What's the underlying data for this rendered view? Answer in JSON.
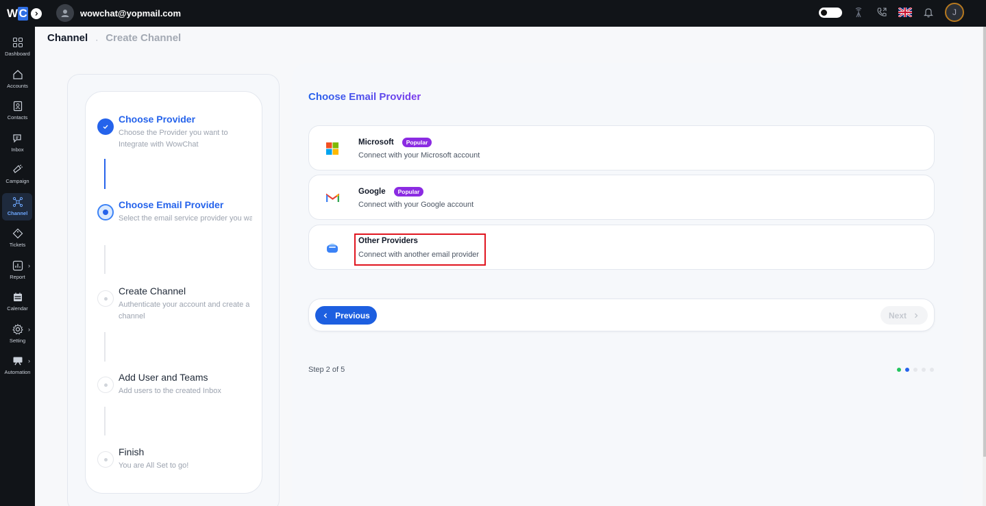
{
  "app": {
    "user_email": "wowchat@yopmail.com",
    "profile_initial": "J"
  },
  "sidebar": {
    "items": [
      {
        "label": "Dashboard",
        "icon": "dashboard-icon"
      },
      {
        "label": "Accounts",
        "icon": "home-icon"
      },
      {
        "label": "Contacts",
        "icon": "contact-card-icon"
      },
      {
        "label": "Inbox",
        "icon": "chat-icon"
      },
      {
        "label": "Campaign",
        "icon": "megaphone-icon"
      },
      {
        "label": "Channel",
        "icon": "channel-icon",
        "active": true
      },
      {
        "label": "Tickets",
        "icon": "ticket-icon"
      },
      {
        "label": "Report",
        "icon": "report-icon"
      },
      {
        "label": "Calendar",
        "icon": "calendar-icon"
      },
      {
        "label": "Setting",
        "icon": "gear-icon"
      },
      {
        "label": "Automation",
        "icon": "automation-icon"
      }
    ]
  },
  "breadcrumb": {
    "parent": "Channel",
    "separator": "·",
    "current": "Create Channel"
  },
  "steps": [
    {
      "title": "Choose Provider",
      "desc": "Choose the Provider you want to Integrate with WowChat",
      "state": "done"
    },
    {
      "title": "Choose Email Provider",
      "desc": "Select the email service provider you want to use for sending and receiving...",
      "state": "current"
    },
    {
      "title": "Create Channel",
      "desc": "Authenticate your account and create a channel",
      "state": "todo"
    },
    {
      "title": "Add User and Teams",
      "desc": "Add users to the created Inbox",
      "state": "todo"
    },
    {
      "title": "Finish",
      "desc": "You are All Set to go!",
      "state": "todo"
    }
  ],
  "main": {
    "title": "Choose Email Provider",
    "providers": [
      {
        "name": "Microsoft",
        "badge": "Popular",
        "desc": "Connect with your Microsoft account",
        "icon": "microsoft-logo-icon"
      },
      {
        "name": "Google",
        "badge": "Popular",
        "desc": "Connect with your Google account",
        "icon": "gmail-logo-icon"
      },
      {
        "name": "Other Providers",
        "desc": "Connect with another email provider",
        "icon": "mailbox-icon"
      }
    ],
    "prev_label": "Previous",
    "next_label": "Next",
    "step_counter": "Step 2 of 5",
    "progress": {
      "current_step": 2,
      "total_steps": 5
    }
  },
  "colors": {
    "accent": "#2563eb",
    "badge": "#8b2be2",
    "highlight": "#e0141e",
    "done_dot": "#22c55e"
  }
}
